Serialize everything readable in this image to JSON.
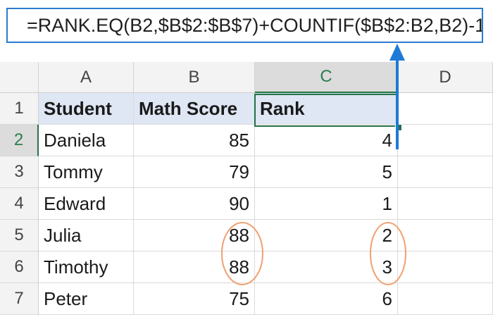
{
  "formula_bar": {
    "text": "=RANK.EQ(B2,$B$2:$B$7)+COUNTIF($B$2:B2,B2)-1"
  },
  "column_headers": [
    "A",
    "B",
    "C",
    "D"
  ],
  "row_headers": [
    "1",
    "2",
    "3",
    "4",
    "5",
    "6",
    "7"
  ],
  "table": {
    "headers": [
      "Student",
      "Math Score",
      "Rank"
    ],
    "rows": [
      {
        "student": "Daniela",
        "score": "85",
        "rank": "4"
      },
      {
        "student": "Tommy",
        "score": "79",
        "rank": "5"
      },
      {
        "student": "Edward",
        "score": "90",
        "rank": "1"
      },
      {
        "student": "Julia",
        "score": "88",
        "rank": "2"
      },
      {
        "student": "Timothy",
        "score": "88",
        "rank": "3"
      },
      {
        "student": "Peter",
        "score": "75",
        "rank": "6"
      }
    ]
  },
  "active_cell": "C2",
  "colors": {
    "formula_border": "#2b7bd0",
    "arrow": "#1e7ad6",
    "highlight_ellipse": "#f0a070",
    "selection": "#217346",
    "header_fill": "#dfe6f4"
  }
}
